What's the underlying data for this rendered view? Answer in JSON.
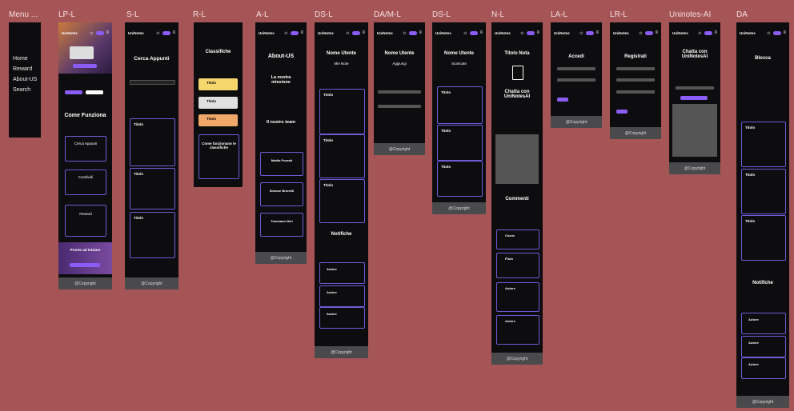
{
  "frames": {
    "menu": {
      "label": "Menu ...",
      "items": [
        "Home",
        "Reward",
        "About-US",
        "Search"
      ]
    },
    "lp": {
      "label": "LP-L",
      "brand": "UniNotes",
      "title": "Come Funziona",
      "cards": [
        "Cerca Appunti",
        "Condividi",
        "Reward"
      ],
      "cta": "Pronto ad Iniziare",
      "footer": "@Copyright"
    },
    "s": {
      "label": "S-L",
      "brand": "UniNotes",
      "title": "Cerca Appunti",
      "card_title": "Titolo",
      "footer": "@Copyright"
    },
    "r": {
      "label": "R-L",
      "title": "Classifiche",
      "entries": [
        "Titolo",
        "Titolo",
        "Titolo"
      ],
      "section": "Come funzionano le classifiche"
    },
    "a": {
      "label": "A-L",
      "brand": "UniNotes",
      "title": "About-US",
      "mission": "La nostra missione",
      "team_title": "Il nostro team",
      "team": [
        "Mattia Pozzati",
        "Simone Brunelli",
        "Tommaso Neri"
      ],
      "footer": "@Copyright"
    },
    "ds1": {
      "label": "DS-L",
      "brand": "UniNotes",
      "title": "Nome Utente",
      "sub": "Mie Note",
      "card_title": "Titolo",
      "notifications": "Notifiche",
      "author": "Autore",
      "footer": "@Copyright"
    },
    "dam": {
      "label": "DA/M-L",
      "brand": "UniNotes",
      "title": "Nome Utente",
      "sub": "Aggiungi",
      "footer": "@Copyright"
    },
    "ds2": {
      "label": "DS-L",
      "brand": "UniNotes",
      "title": "Nome Utente",
      "sub": "Scaricate",
      "card_title": "Titolo",
      "footer": "@Copyright"
    },
    "n": {
      "label": "N-L",
      "brand": "UniNotes",
      "title": "Titolo Nota",
      "chat": "Chatta con UniNotesAI",
      "comments": "Commenti",
      "commenters": [
        "Ciccio",
        "Pluto",
        "Autore",
        "Autore"
      ],
      "footer": "@Copyright"
    },
    "la": {
      "label": "LA-L",
      "brand": "UniNotes",
      "title": "Accedi",
      "footer": "@Copyright"
    },
    "lr": {
      "label": "LR-L",
      "brand": "UniNotes",
      "title": "Registrati",
      "footer": "@Copyright"
    },
    "ai": {
      "label": "Uninotes-AI",
      "brand": "UniNotes",
      "title": "Chatta con UniNotesAI",
      "footer": "@Copyright"
    },
    "da": {
      "label": "DA",
      "brand": "UniNotes",
      "title": "Blocca",
      "card_title": "Titolo",
      "notifications": "Notifiche",
      "author": "Autore",
      "footer": "@Copyright"
    }
  },
  "colors": {
    "canvas": "#a65556",
    "frame": "#0d0d0f",
    "accent": "#8b5cf6",
    "footer": "#4a4a4d"
  }
}
